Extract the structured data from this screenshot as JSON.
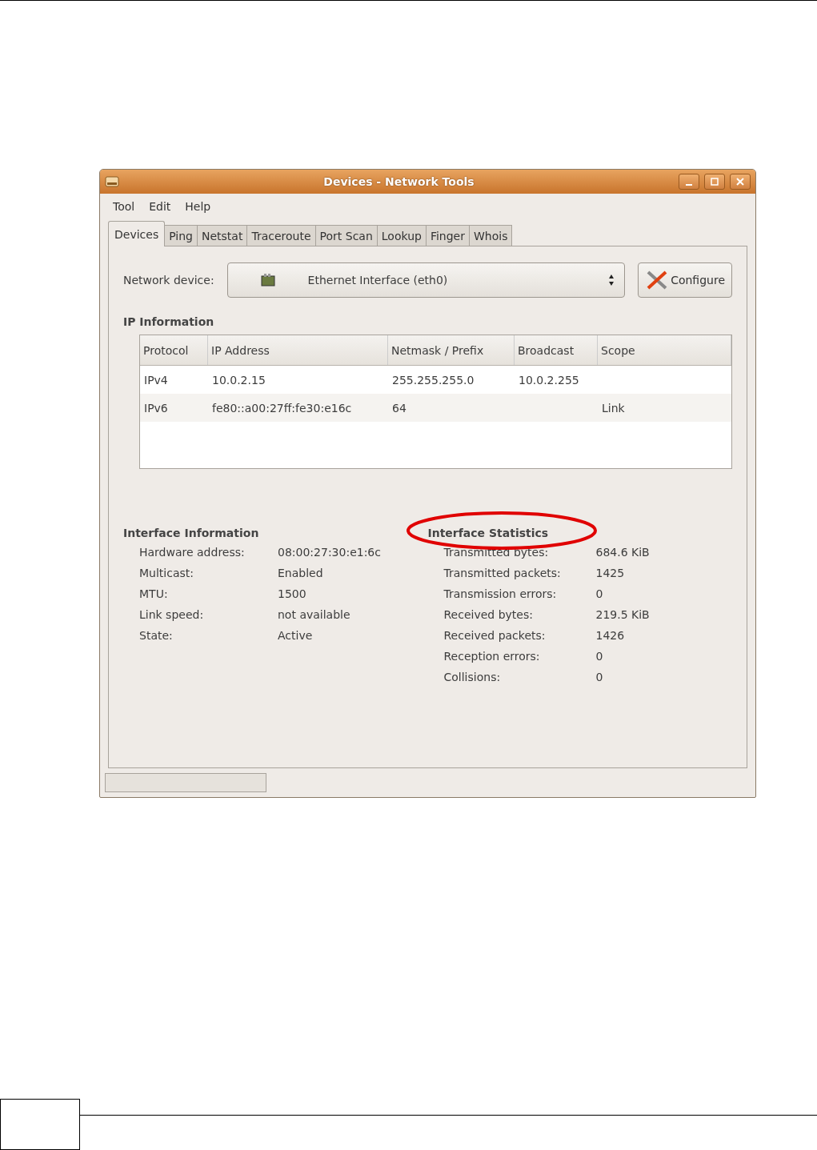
{
  "window": {
    "title": "Devices - Network Tools"
  },
  "menu": [
    "Tool",
    "Edit",
    "Help"
  ],
  "tabs": [
    {
      "label": "Devices",
      "selected": true
    },
    {
      "label": "Ping",
      "selected": false
    },
    {
      "label": "Netstat",
      "selected": false
    },
    {
      "label": "Traceroute",
      "selected": false
    },
    {
      "label": "Port Scan",
      "selected": false
    },
    {
      "label": "Lookup",
      "selected": false
    },
    {
      "label": "Finger",
      "selected": false
    },
    {
      "label": "Whois",
      "selected": false
    }
  ],
  "device": {
    "label": "Network device:",
    "value": "Ethernet Interface (eth0)",
    "button": "Configure"
  },
  "ip_information": {
    "title": "IP Information",
    "columns": [
      "Protocol",
      "IP Address",
      "Netmask / Prefix",
      "Broadcast",
      "Scope"
    ],
    "rows": [
      [
        "IPv4",
        "10.0.2.15",
        "255.255.255.0",
        "10.0.2.255",
        ""
      ],
      [
        "IPv6",
        "fe80::a00:27ff:fe30:e16c",
        "64",
        "",
        "Link"
      ]
    ]
  },
  "interface_information": {
    "title": "Interface Information",
    "items": [
      {
        "label": "Hardware address:",
        "value": "08:00:27:30:e1:6c"
      },
      {
        "label": "Multicast:",
        "value": "Enabled"
      },
      {
        "label": "MTU:",
        "value": "1500"
      },
      {
        "label": "Link speed:",
        "value": "not available"
      },
      {
        "label": "State:",
        "value": "Active"
      }
    ]
  },
  "interface_statistics": {
    "title": "Interface Statistics",
    "highlighted": true,
    "items": [
      {
        "label": "Transmitted bytes:",
        "value": "684.6 KiB"
      },
      {
        "label": "Transmitted packets:",
        "value": "1425"
      },
      {
        "label": "Transmission errors:",
        "value": "0"
      },
      {
        "label": "Received bytes:",
        "value": "219.5 KiB"
      },
      {
        "label": "Received packets:",
        "value": "1426"
      },
      {
        "label": "Reception errors:",
        "value": "0"
      },
      {
        "label": "Collisions:",
        "value": "0"
      }
    ]
  }
}
